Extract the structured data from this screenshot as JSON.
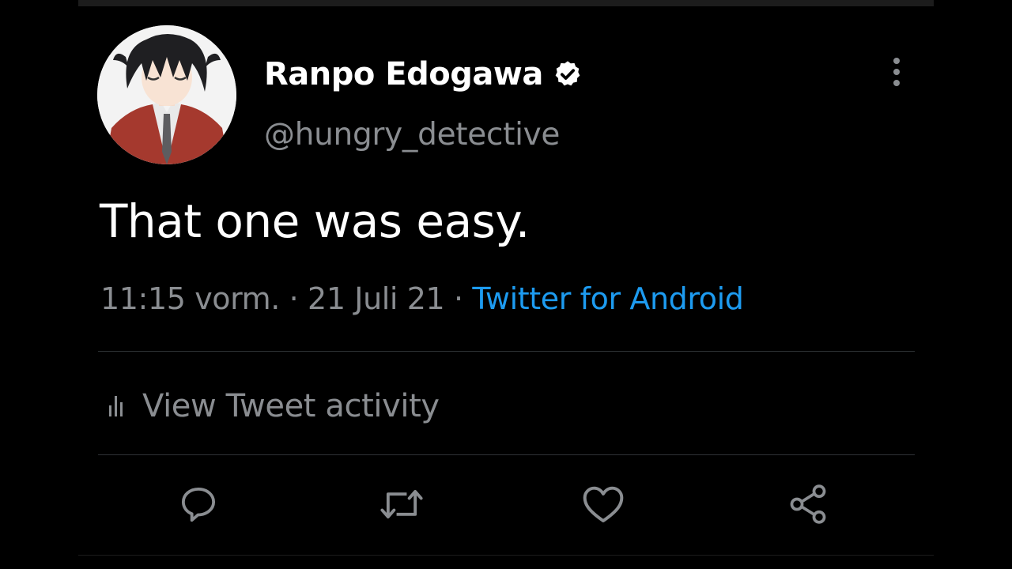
{
  "tweet": {
    "author": {
      "display_name": "Ranpo Edogawa",
      "handle": "@hungry_detective",
      "verified": true,
      "avatar_icon": "anime-avatar"
    },
    "text": "That one was easy.",
    "timestamp": {
      "time": "11:15 vorm.",
      "separator": "·",
      "date": "21 Juli 21",
      "source": "Twitter for Android"
    },
    "activity_label": "View Tweet activity",
    "actions": [
      {
        "name": "reply",
        "icon": "comment-icon"
      },
      {
        "name": "retweet",
        "icon": "retweet-icon"
      },
      {
        "name": "like",
        "icon": "heart-icon"
      },
      {
        "name": "share",
        "icon": "share-icon"
      }
    ]
  },
  "colors": {
    "background": "#000000",
    "text_primary": "#ffffff",
    "text_secondary": "#8a8d91",
    "link": "#1d9bf0",
    "divider": "#2f3336"
  }
}
